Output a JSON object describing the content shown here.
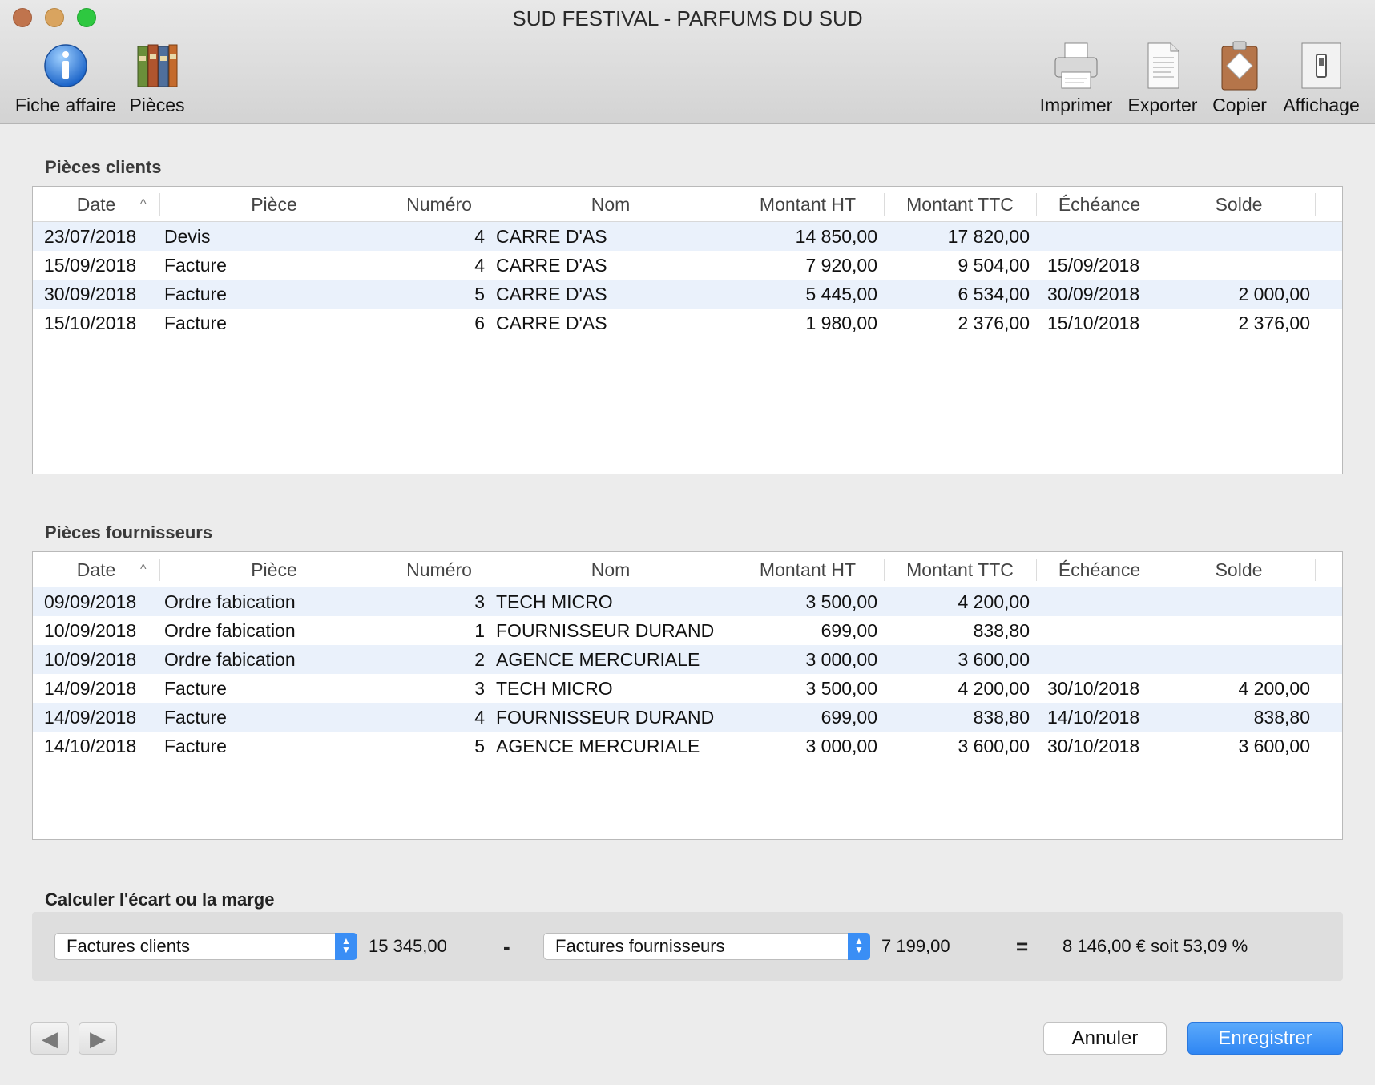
{
  "window": {
    "title": "SUD FESTIVAL - PARFUMS DU SUD"
  },
  "toolbar": {
    "left": [
      {
        "label": "Fiche affaire",
        "icon": "info-icon"
      },
      {
        "label": "Pièces",
        "icon": "binders-icon"
      }
    ],
    "right": [
      {
        "label": "Imprimer",
        "icon": "printer-icon"
      },
      {
        "label": "Exporter",
        "icon": "document-icon"
      },
      {
        "label": "Copier",
        "icon": "clipboard-icon"
      },
      {
        "label": "Affichage",
        "icon": "switch-icon"
      }
    ]
  },
  "columns": [
    "Date",
    "Pièce",
    "Numéro",
    "Nom",
    "Montant HT",
    "Montant TTC",
    "Échéance",
    "Solde"
  ],
  "clients": {
    "label": "Pièces clients",
    "rows": [
      [
        "23/07/2018",
        "Devis",
        "4",
        "CARRE D'AS",
        "14 850,00",
        "17 820,00",
        "",
        ""
      ],
      [
        "15/09/2018",
        "Facture",
        "4",
        "CARRE D'AS",
        "7 920,00",
        "9 504,00",
        "15/09/2018",
        ""
      ],
      [
        "30/09/2018",
        "Facture",
        "5",
        "CARRE D'AS",
        "5 445,00",
        "6 534,00",
        "30/09/2018",
        "2 000,00"
      ],
      [
        "15/10/2018",
        "Facture",
        "6",
        "CARRE D'AS",
        "1 980,00",
        "2 376,00",
        "15/10/2018",
        "2 376,00"
      ]
    ]
  },
  "fournisseurs": {
    "label": "Pièces fournisseurs",
    "rows": [
      [
        "09/09/2018",
        "Ordre fabication",
        "3",
        "TECH MICRO",
        "3 500,00",
        "4 200,00",
        "",
        ""
      ],
      [
        "10/09/2018",
        "Ordre fabication",
        "1",
        "FOURNISSEUR DURAND",
        "699,00",
        "838,80",
        "",
        ""
      ],
      [
        "10/09/2018",
        "Ordre fabication",
        "2",
        "AGENCE MERCURIALE",
        "3 000,00",
        "3 600,00",
        "",
        ""
      ],
      [
        "14/09/2018",
        "Facture",
        "3",
        "TECH MICRO",
        "3 500,00",
        "4 200,00",
        "30/10/2018",
        "4 200,00"
      ],
      [
        "14/09/2018",
        "Facture",
        "4",
        "FOURNISSEUR DURAND",
        "699,00",
        "838,80",
        "14/10/2018",
        "838,80"
      ],
      [
        "14/10/2018",
        "Facture",
        "5",
        "AGENCE MERCURIALE",
        "3 000,00",
        "3 600,00",
        "30/10/2018",
        "3 600,00"
      ]
    ]
  },
  "calc": {
    "label": "Calculer l'écart ou la marge",
    "left_select": "Factures clients",
    "left_value": "15 345,00",
    "minus": "-",
    "right_select": "Factures fournisseurs",
    "right_value": "7 199,00",
    "equals": "=",
    "result": "8 146,00 € soit 53,09 %"
  },
  "buttons": {
    "cancel": "Annuler",
    "save": "Enregistrer"
  }
}
